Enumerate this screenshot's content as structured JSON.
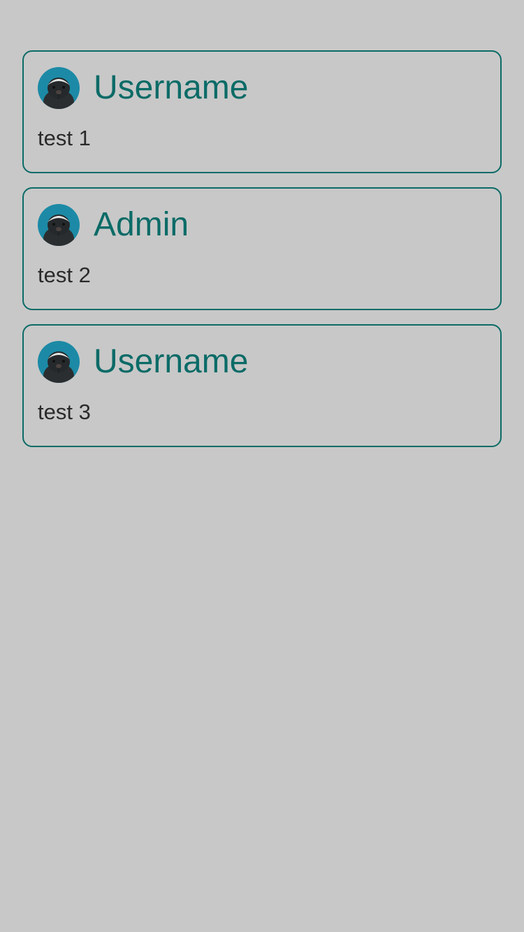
{
  "colors": {
    "background": "#c8c8c8",
    "accent": "#0b6b67",
    "text": "#2a2a2a",
    "avatar_bg": "#1c8aa6"
  },
  "posts": [
    {
      "author": "Username",
      "text": "test 1",
      "avatar_icon": "honey-badger-avatar"
    },
    {
      "author": "Admin",
      "text": "test 2",
      "avatar_icon": "honey-badger-avatar"
    },
    {
      "author": "Username",
      "text": "test 3",
      "avatar_icon": "honey-badger-avatar"
    }
  ]
}
